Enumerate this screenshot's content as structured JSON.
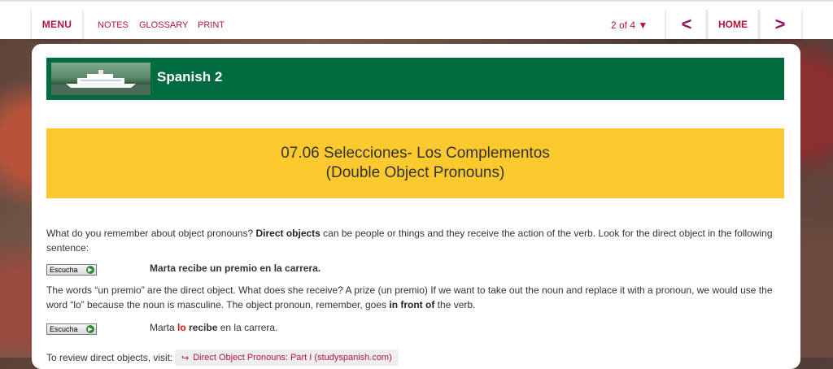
{
  "topbar": {
    "menu_label": "MENU",
    "links": [
      "NOTES",
      "GLOSSARY",
      "PRINT"
    ],
    "page_count": "2 of 4 ▼",
    "prev_arrow": "<",
    "home_label": "HOME",
    "next_arrow": ">"
  },
  "banner": {
    "title": "Spanish 2"
  },
  "lesson": {
    "title_line1": "07.06 Selecciones- Los Complementos",
    "title_line2": "(Double Object Pronouns)"
  },
  "content": {
    "intro_pre": "What do you remember about object pronouns? ",
    "intro_bold": "Direct objects",
    "intro_post": " can be people or things and they receive the action of the verb. Look for the direct object in the following sentence:",
    "escucha_label": "Escucha",
    "example1": "Marta recibe un premio en la carrera.",
    "explanation_pre": "The words “un premio” are the direct object. What does she receive? A prize (un premio) If we want to take out the noun and replace it with a pronoun, we would use the word “lo” because the noun is masculine. The object pronoun, remember, goes ",
    "explanation_bold": "in front of",
    "explanation_post": " the verb.",
    "example2_pre": "Marta ",
    "example2_pronoun": "lo",
    "example2_verb": "recibe",
    "example2_post": " en la carrera.",
    "review_text": "To review direct objects, visit:",
    "review_link": "Direct Object Pronouns: Part I (studyspanish.com)"
  },
  "colors": {
    "accent": "#b5143a",
    "banner_green": "#006b3f",
    "title_yellow": "#fcc92e",
    "pronoun_red": "#d2131c"
  }
}
